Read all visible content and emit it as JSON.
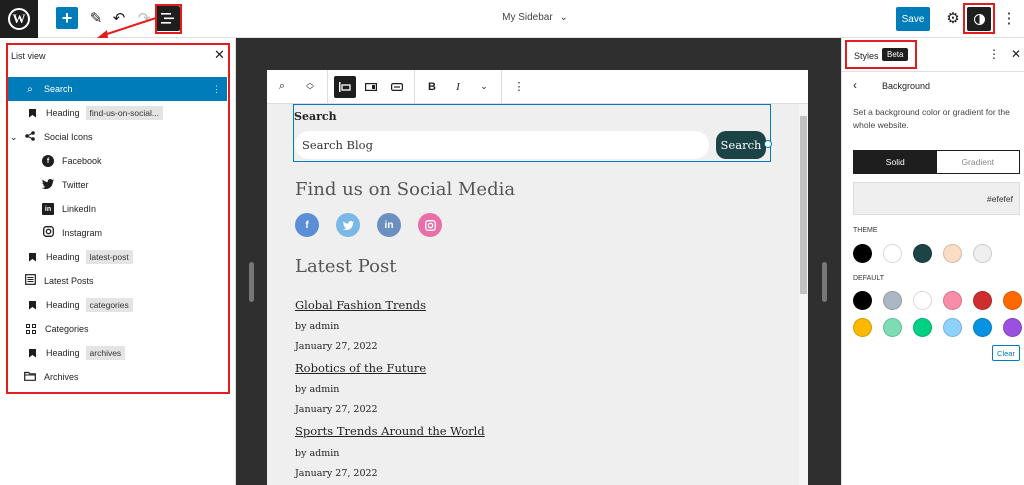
{
  "topbar": {
    "logo_letter": "W",
    "add_label": "+",
    "edit_icon": "✎",
    "undo_icon": "↶",
    "redo_icon": "↷",
    "doc_title": "My Sidebar",
    "chevron": "⌄",
    "save_label": "Save",
    "settings_icon": "⚙",
    "more_icon": "⋮"
  },
  "list_view": {
    "title": "List view",
    "close": "✕",
    "items": [
      {
        "label": "Search",
        "tag": "",
        "icon": "search-icon"
      },
      {
        "label": "Heading",
        "tag": "find-us-on-social...",
        "icon": "bookmark-icon"
      },
      {
        "label": "Social Icons",
        "tag": "",
        "icon": "share-icon"
      },
      {
        "label": "Facebook",
        "tag": "",
        "icon": "facebook-icon"
      },
      {
        "label": "Twitter",
        "tag": "",
        "icon": "twitter-icon"
      },
      {
        "label": "LinkedIn",
        "tag": "",
        "icon": "linkedin-icon"
      },
      {
        "label": "Instagram",
        "tag": "",
        "icon": "instagram-icon"
      },
      {
        "label": "Heading",
        "tag": "latest-post",
        "icon": "bookmark-icon"
      },
      {
        "label": "Latest Posts",
        "tag": "",
        "icon": "list-icon"
      },
      {
        "label": "Heading",
        "tag": "categories",
        "icon": "bookmark-icon"
      },
      {
        "label": "Categories",
        "tag": "",
        "icon": "grid-icon"
      },
      {
        "label": "Heading",
        "tag": "archives",
        "icon": "bookmark-icon"
      },
      {
        "label": "Archives",
        "tag": "",
        "icon": "folder-icon"
      }
    ]
  },
  "block_toolbar": {
    "bold": "B",
    "italic": "I"
  },
  "canvas": {
    "search_label": "Search",
    "search_placeholder": "Search Blog",
    "search_button": "Search",
    "social_heading": "Find us on Social Media",
    "latest_heading": "Latest Post",
    "posts": [
      {
        "title": "Global Fashion Trends",
        "author": "by admin",
        "date": "January 27, 2022"
      },
      {
        "title": "Robotics of the Future",
        "author": "by admin",
        "date": "January 27, 2022"
      },
      {
        "title": "Sports Trends Around the World",
        "author": "by admin",
        "date": "January 27, 2022"
      }
    ],
    "social_colors": [
      "#5a8fd8",
      "#7ab8e8",
      "#6b8fbf",
      "#e86fa8"
    ]
  },
  "styles_panel": {
    "title": "Styles",
    "badge": "Beta",
    "section_title": "Background",
    "description": "Set a background color or gradient for the whole website.",
    "tab_solid": "Solid",
    "tab_gradient": "Gradient",
    "color_value": "#efefef",
    "theme_label": "THEME",
    "default_label": "DEFAULT",
    "clear_label": "Clear",
    "theme_colors": [
      "#000000",
      "#ffffff",
      "#1c4447",
      "#fbdcc4",
      "#efefef"
    ],
    "default_colors_row1": [
      "#000000",
      "#abb8c3",
      "#ffffff",
      "#f78da7",
      "#cf2e2e",
      "#ff6900"
    ],
    "default_colors_row2": [
      "#fcb900",
      "#7bdcb5",
      "#00d084",
      "#8ed1fc",
      "#0693e3",
      "#9b51e0"
    ]
  }
}
